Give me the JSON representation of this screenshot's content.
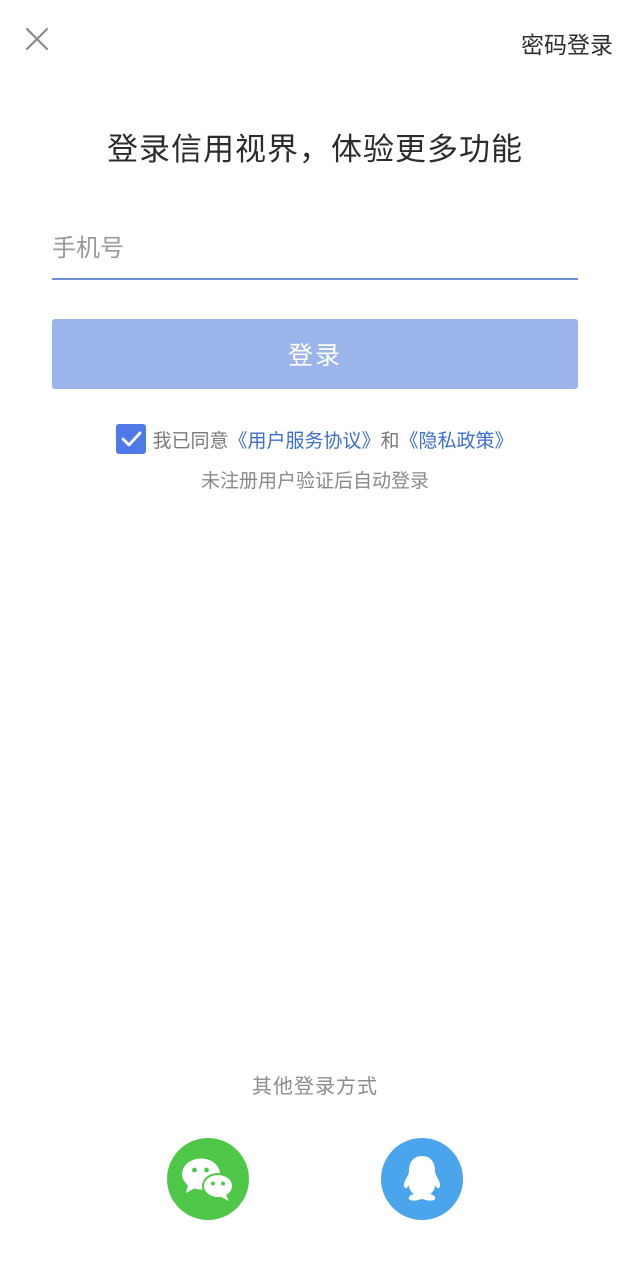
{
  "header": {
    "password_login": "密码登录"
  },
  "title": "登录信用视界，体验更多功能",
  "phone": {
    "placeholder": "手机号",
    "value": ""
  },
  "login_button": "登录",
  "agreement": {
    "prefix": "我已同意",
    "user_agreement": "《用户服务协议》",
    "and": "和",
    "privacy_policy": "《隐私政策》",
    "checked": true,
    "note": "未注册用户验证后自动登录"
  },
  "other_login": {
    "title": "其他登录方式",
    "options": [
      {
        "icon": "wechat-icon",
        "color": "#4fc84a"
      },
      {
        "icon": "qq-icon",
        "color": "#4ba5ec"
      }
    ]
  },
  "colors": {
    "accent": "#4f79e6",
    "button": "#9bb5ea",
    "link": "#3d6fcf"
  }
}
